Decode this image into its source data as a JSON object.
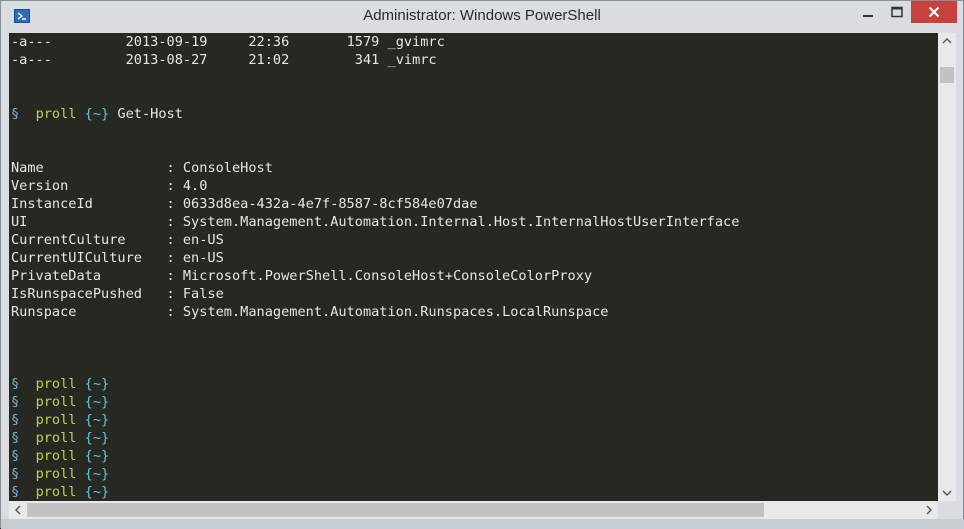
{
  "window": {
    "title": "Administrator: Windows PowerShell"
  },
  "icons": {
    "app": "powershell-icon",
    "minimize": "minimize-icon",
    "maximize": "maximize-icon",
    "close": "close-icon",
    "scroll_up": "arrow-up-icon",
    "scroll_down": "arrow-down-icon",
    "scroll_left": "arrow-left-icon",
    "scroll_right": "arrow-right-icon"
  },
  "colors": {
    "console_background": "#272822",
    "prompt_symbol": "#6fb3e8",
    "prompt_user": "#b8d64a",
    "prompt_path": "#5fc6e0",
    "close_button": "#c7423f"
  },
  "console": {
    "file_rows": [
      {
        "mode": "-a---",
        "date": "2013-09-19",
        "time": "22:36",
        "size": "1579",
        "name": "_gvimrc"
      },
      {
        "mode": "-a---",
        "date": "2013-08-27",
        "time": "21:02",
        "size": "341",
        "name": "_vimrc"
      }
    ],
    "command_prompt": {
      "symbol": "§",
      "user": "proll",
      "path": "{~}",
      "command": "Get-Host"
    },
    "host_properties": [
      {
        "key": "Name",
        "value": "ConsoleHost"
      },
      {
        "key": "Version",
        "value": "4.0"
      },
      {
        "key": "InstanceId",
        "value": "0633d8ea-432a-4e7f-8587-8cf584e07dae"
      },
      {
        "key": "UI",
        "value": "System.Management.Automation.Internal.Host.InternalHostUserInterface"
      },
      {
        "key": "CurrentCulture",
        "value": "en-US"
      },
      {
        "key": "CurrentUICulture",
        "value": "en-US"
      },
      {
        "key": "PrivateData",
        "value": "Microsoft.PowerShell.ConsoleHost+ConsoleColorProxy"
      },
      {
        "key": "IsRunspacePushed",
        "value": "False"
      },
      {
        "key": "Runspace",
        "value": "System.Management.Automation.Runspaces.LocalRunspace"
      }
    ],
    "empty_prompts": [
      {
        "symbol": "§",
        "user": "proll",
        "path": "{~}"
      },
      {
        "symbol": "§",
        "user": "proll",
        "path": "{~}"
      },
      {
        "symbol": "§",
        "user": "proll",
        "path": "{~}"
      },
      {
        "symbol": "§",
        "user": "proll",
        "path": "{~}"
      },
      {
        "symbol": "§",
        "user": "proll",
        "path": "{~}"
      },
      {
        "symbol": "§",
        "user": "proll",
        "path": "{~}"
      },
      {
        "symbol": "§",
        "user": "proll",
        "path": "{~}"
      }
    ]
  }
}
